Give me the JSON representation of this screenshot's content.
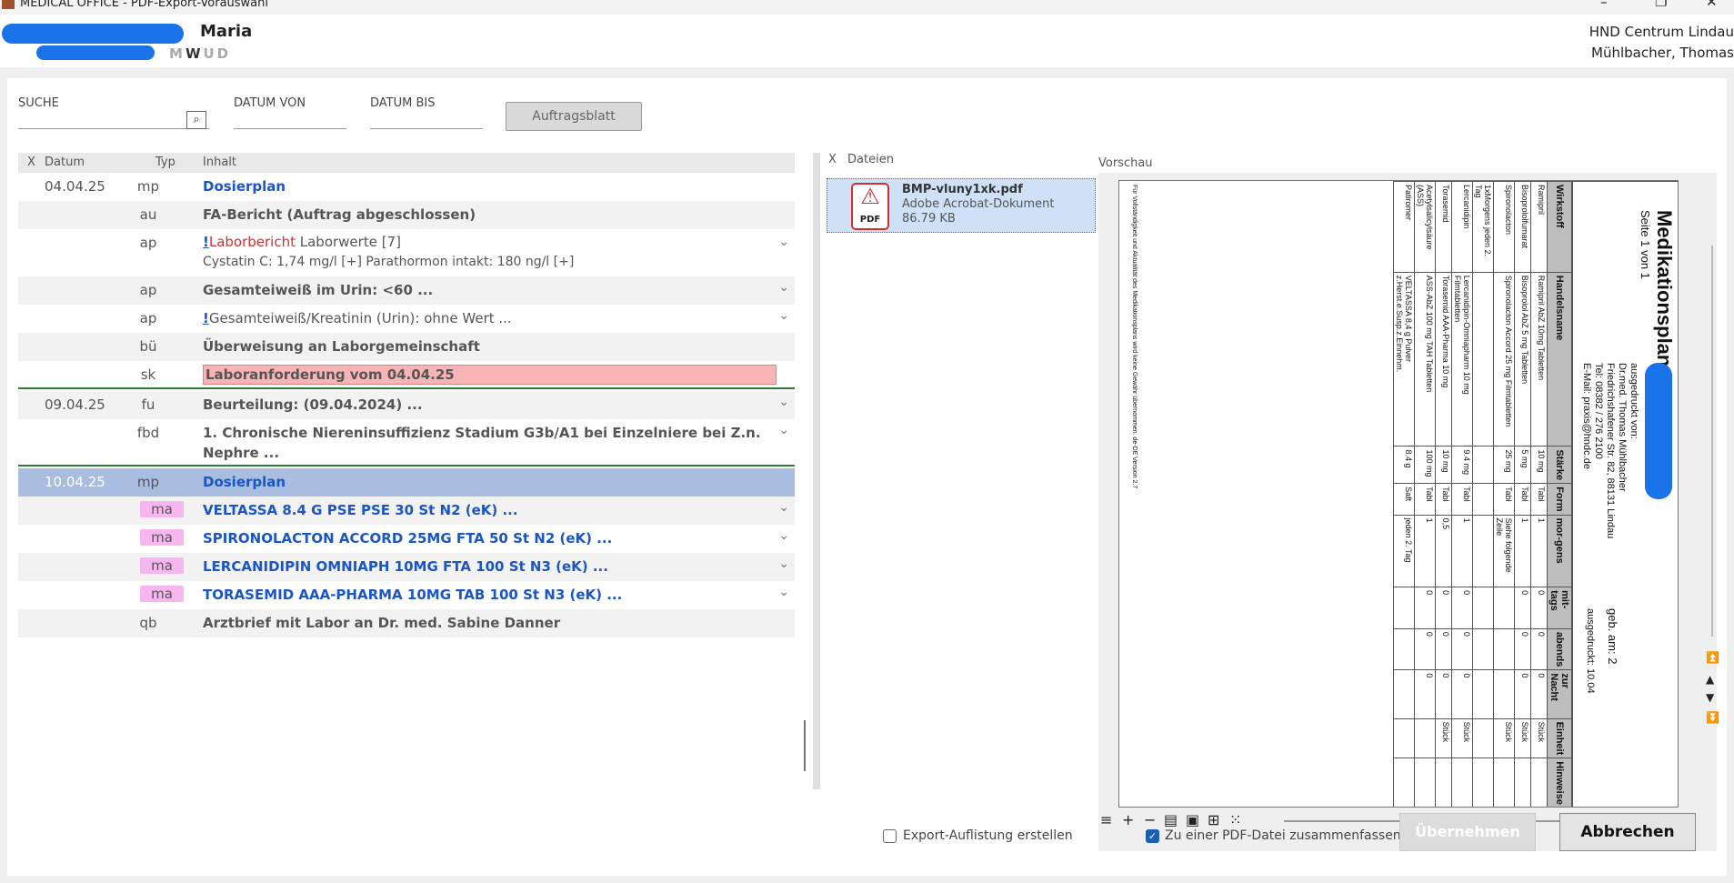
{
  "window": {
    "title": "MEDICAL OFFICE - PDF-Export-Vorauswahl"
  },
  "header": {
    "patient_name_visible": "Maria",
    "weekday_prefix": "M",
    "weekday_current": "W",
    "weekday_suffix": "UD",
    "org_name": "HND Centrum Lindau",
    "doctor": "Mühlbacher, Thomas"
  },
  "filters": {
    "search_label": "SUCHE",
    "date_from_label": "DATUM  VON",
    "date_to_label": "DATUM  BIS",
    "order_button": "Auftragsblatt"
  },
  "list": {
    "headers": {
      "x": "X",
      "date": "Datum",
      "type": "Typ",
      "content": "Inhalt"
    },
    "rows": [
      {
        "date": "04.04.25",
        "type": "mp",
        "text": "Dosierplan"
      },
      {
        "date": "",
        "type": "au",
        "text": "FA-Bericht (Auftrag abgeschlossen)"
      },
      {
        "date": "",
        "type": "ap",
        "marker": "!",
        "text_red": "Laborbericht",
        "text_rest": " Laborwerte [7]",
        "line2": "Cystatin C: 1,74 mg/l [+]    Parathormon intakt: 180 ng/l [+]"
      },
      {
        "date": "",
        "type": "ap",
        "text": "Gesamteiweiß im Urin: <60 ..."
      },
      {
        "date": "",
        "type": "ap",
        "marker": "!",
        "text": "Gesamteiweiß/Kreatinin (Urin): ohne Wert ..."
      },
      {
        "date": "",
        "type": "bü",
        "text": "Überweisung an Laborgemeinschaft"
      },
      {
        "date": "",
        "type": "sk",
        "text": "Laboranforderung vom 04.04.25"
      },
      {
        "date": "09.04.25",
        "type": "fu",
        "text": "Beurteilung: (09.04.2024) ..."
      },
      {
        "date": "",
        "type": "fbd",
        "text": "1.  Chronische Niereninsuffizienz Stadium G3b/A1 bei Einzelniere bei Z.n.",
        "line2": "Nephre ..."
      },
      {
        "date": "10.04.25",
        "type": "mp",
        "text": "Dosierplan"
      },
      {
        "date": "",
        "type": "ma",
        "text": "VELTASSA 8.4 G PSE PSE 30 St N2 (eK) ..."
      },
      {
        "date": "",
        "type": "ma",
        "text": "SPIRONOLACTON ACCORD 25MG FTA 50 St N2 (eK) ..."
      },
      {
        "date": "",
        "type": "ma",
        "text": "LERCANIDIPIN OMNIAPH 10MG FTA 100 St N3 (eK) ..."
      },
      {
        "date": "",
        "type": "ma",
        "text": "TORASEMID AAA-PHARMA 10MG TAB 100 St N3 (eK) ..."
      },
      {
        "date": "",
        "type": "qb",
        "text": "Arztbrief mit Labor an Dr. med. Sabine Danner"
      }
    ]
  },
  "files": {
    "header_x": "X",
    "header": "Dateien",
    "item": {
      "name": "BMP-vluny1xk.pdf",
      "kind": "Adobe Acrobat-Dokument",
      "size": "86.79 KB",
      "icon_label": "PDF"
    }
  },
  "preview": {
    "label": "Vorschau",
    "doc": {
      "title": "Medikationsplan",
      "subtitle": "Seite 1 von 1",
      "printed_by_label": "ausgedruckt von:",
      "address": [
        "Dr.med. Thomas Mühlbacher",
        "Friedrichshafener Str. 82, 88131 Lindau",
        "Tel: 08382 / 276 2100",
        "E-Mail: praxis@hndc.de"
      ],
      "printed_on": "ausgedruckt: 10.04",
      "born": "geb. am: 2",
      "columns": [
        "Wirkstoff",
        "Handelsname",
        "Stärke",
        "Form",
        "mor-gens",
        "mit-tags",
        "abends",
        "zur Nacht",
        "Einheit",
        "Hinweise"
      ],
      "rows": [
        [
          "Ramipril",
          "Ramipril AbZ 10mg Tabletten",
          "10 mg",
          "Tabl",
          "1",
          "0",
          "0",
          "0",
          "Stück",
          ""
        ],
        [
          "Bisoprololfumarat",
          "Bisoprolol AbZ 5 mg Tabletten",
          "5 mg",
          "Tabl",
          "1",
          "0",
          "0",
          "0",
          "Stück",
          ""
        ],
        [
          "Spironolacton",
          "Spironolacton Accord 25 mg Filmtabletten",
          "25 mg",
          "Tabl",
          "Siehe folgende Zeile",
          "",
          "",
          "",
          "Stück",
          ""
        ],
        [
          "1xMorgens jeden 2. Tag",
          "",
          "",
          "",
          "",
          "",
          "",
          "",
          "",
          ""
        ],
        [
          "Lercanidipin",
          "Lercanidipin-Omniapharm 10 mg Filmtabletten",
          "9.4 mg",
          "Tabl",
          "1",
          "0",
          "0",
          "0",
          "Stück",
          ""
        ],
        [
          "Torasemid",
          "Torasemid AAA-Pharma 10 mg",
          "10 mg",
          "Tabl",
          "0,5",
          "0",
          "0",
          "0",
          "Stück",
          ""
        ],
        [
          "Acetylsalicylsäure (ASS)",
          "ASS-AbZ 100 mg TAH Tabletten",
          "100 mg",
          "Tabl",
          "1",
          "0",
          "0",
          "0",
          "",
          ""
        ],
        [
          "Patiromer",
          "VELTASSA 8,4 g Pulver z.Herst.e.Susp.z.Einnehm.",
          "8.4 g",
          "Saft",
          "jeden 2. Tag",
          "",
          "",
          "",
          "",
          ""
        ]
      ],
      "footer": "Für Vollständigkeit und Aktualität des Medikationsplans wird keine Gewähr übernommen. de-DE Version 2.7"
    }
  },
  "footer": {
    "export_list_label": "Export-Auflistung erstellen",
    "merge_pdf_label": "Zu einer PDF-Datei zusammenfassen",
    "ok_button": "Übernehmen",
    "cancel_button": "Abbrechen"
  },
  "colors": {
    "accent_blue": "#1a56c4",
    "selection": "#a9bde0",
    "alert_pink": "#f9b5b5",
    "med_type_pink": "#f7b6f0",
    "pdf_red": "#d32f2f"
  }
}
